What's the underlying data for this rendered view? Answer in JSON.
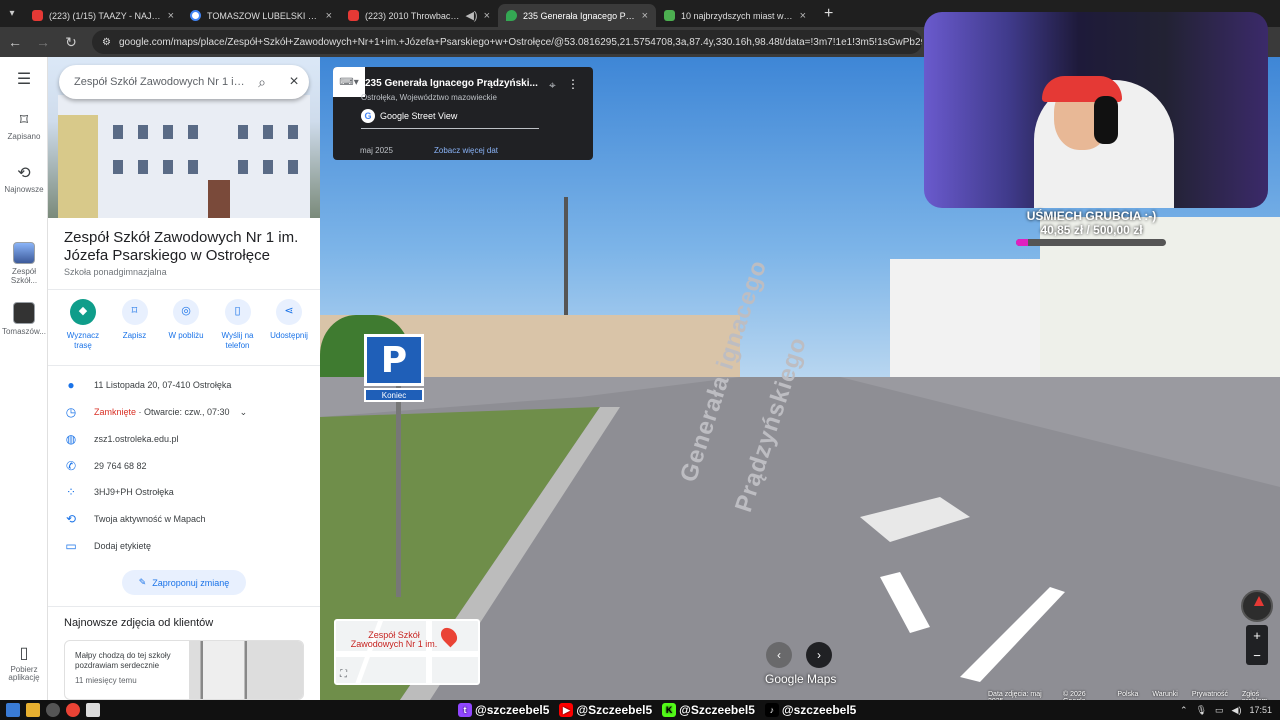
{
  "browser": {
    "tabs": [
      {
        "label": "(223) (1/15) TAAZY - NAJLEPSZ",
        "icon": "youtube-icon",
        "active": false
      },
      {
        "label": "TOMASZOW LUBELSKI MAPY G",
        "icon": "google-icon",
        "active": false
      },
      {
        "label": "(223) 2010 Throwback DJ Se",
        "icon": "youtube-icon",
        "active": false
      },
      {
        "label": "235 Generała Ignacego Prądzyń",
        "icon": "maps-icon",
        "active": true
      },
      {
        "label": "10 najbrzydszych miast w Polsc",
        "icon": "document-icon",
        "active": false
      }
    ],
    "new_tab": "+",
    "url": "google.com/maps/place/Zespół+Szkół+Zawodowych+Nr+1+im.+Józefa+Psarskiego+w+Ostrołęce/@53.0816295,21.5754708,3a,87.4y,330.16h,98.48t/data=!3m7!1e1!3m5!1sGwPb29QDpHJEor7M--"
  },
  "rail": {
    "items": [
      {
        "label": "Zapisano",
        "icon": "bookmark-icon"
      },
      {
        "label": "Najnowsze",
        "icon": "history-icon"
      },
      {
        "label": "Zespół Szkół...",
        "icon": "place-thumb-icon"
      },
      {
        "label": "Tomaszów...",
        "icon": "place-thumb-icon"
      },
      {
        "label": "Pobierz aplikację",
        "icon": "phone-icon"
      }
    ]
  },
  "search": {
    "value": "Zespół Szkół Zawodowych Nr 1 im."
  },
  "place": {
    "name": "Zespół Szkół Zawodowych Nr 1 im. Józefa Psarskiego w Ostrołęce",
    "type": "Szkoła ponadgimnazjalna",
    "actions": [
      {
        "label": "Wyznacz trasę",
        "icon": "directions-icon"
      },
      {
        "label": "Zapisz",
        "icon": "bookmark-icon"
      },
      {
        "label": "W pobliżu",
        "icon": "nearby-icon"
      },
      {
        "label": "Wyślij na telefon",
        "icon": "send-to-phone-icon"
      },
      {
        "label": "Udostępnij",
        "icon": "share-icon"
      }
    ],
    "address": "11 Listopada 20, 07-410 Ostrołęka",
    "hours_status": "Zamknięte",
    "hours_next": " · Otwarcie: czw., 07:30",
    "website": "zsz1.ostroleka.edu.pl",
    "phone": "29 764 68 82",
    "plus_code": "3HJ9+PH Ostrołęka",
    "activity": "Twoja aktywność w Mapach",
    "add_label": "Dodaj etykietę",
    "suggest_edit": "Zaproponuj zmianę",
    "reviews_title": "Najnowsze zdjęcia od klientów",
    "review": {
      "text": "Małpy chodzą do tej szkoły pozdrawiam serdecznie",
      "date": "11 miesięcy temu"
    }
  },
  "streetview": {
    "title": "235 Generała Ignacego Prądzyński...",
    "subtitle": "Ostrołęka, Województwo mazowieckie",
    "provider": "Google Street View",
    "date": "maj 2025",
    "more_dates": "Zobacz więcej dat",
    "road_text_1": "Generała ignacego",
    "road_text_2": "Prądzyńskiego",
    "sign": "P",
    "sign_sub": "Koniec",
    "minimap_label": "Zespół Szkół Zawodowych Nr 1 im.",
    "logo": "Google Maps",
    "footer": [
      "Data zdjęcia: maj 2025",
      "© 2026 Google",
      "Polska",
      "Warunki",
      "Prywatność",
      "Zgłoś problem"
    ]
  },
  "stream": {
    "goal_title": "UŚMIECH GRUBCIA :-)",
    "goal_amount": "40,85 zł / 500,00 zł",
    "goal_fraction": 0.0817,
    "socials": [
      {
        "handle": "@szczeebel5",
        "icon": "twitch-icon",
        "color": "#9146ff"
      },
      {
        "handle": "@Szczeebel5",
        "icon": "youtube-icon",
        "color": "#ff0000"
      },
      {
        "handle": "@Szczeebel5",
        "icon": "kick-icon",
        "color": "#53fc18"
      },
      {
        "handle": "@szczeebel5",
        "icon": "tiktok-icon",
        "color": "#000000"
      }
    ]
  },
  "taskbar": {
    "time": "17:51"
  }
}
